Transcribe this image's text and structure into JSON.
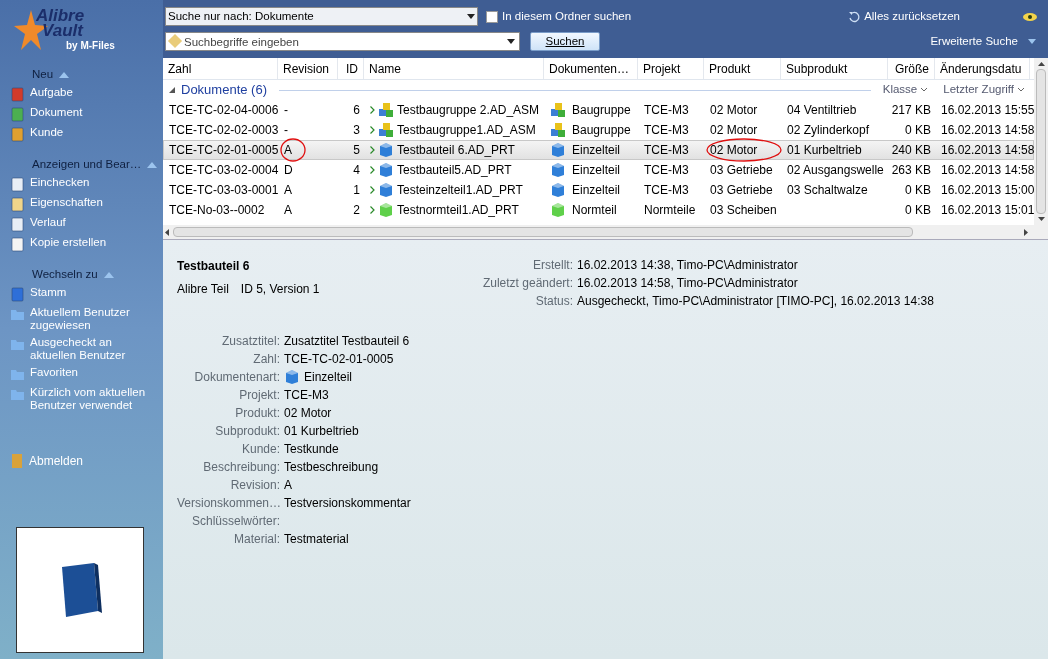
{
  "logo": {
    "line1": "Alibre",
    "line2": "Vault",
    "byline": "by M-Files"
  },
  "sidebar": {
    "sections": [
      {
        "title": "Neu",
        "items": [
          {
            "label": "Aufgabe"
          },
          {
            "label": "Dokument"
          },
          {
            "label": "Kunde"
          }
        ]
      },
      {
        "title": "Anzeigen und Bear…",
        "items": [
          {
            "label": "Einchecken"
          },
          {
            "label": "Eigenschaften"
          },
          {
            "label": "Verlauf"
          },
          {
            "label": "Kopie erstellen"
          }
        ]
      },
      {
        "title": "Wechseln zu",
        "items": [
          {
            "label": "Stamm"
          },
          {
            "label": "Aktuellem Benutzer zugewiesen"
          },
          {
            "label": "Ausgecheckt an aktuellen Benutzer"
          },
          {
            "label": "Favoriten"
          },
          {
            "label": "Kürzlich vom aktuellen Benutzer verwendet"
          }
        ]
      }
    ],
    "logout": "Abmelden"
  },
  "search": {
    "scope": "Suche nur nach: Dokumente",
    "in_folder_label": "In diesem Ordner suchen",
    "in_folder_checked": false,
    "placeholder": "Suchbegriffe eingeben",
    "button": "Suchen",
    "reset": "Alles zurücksetzen",
    "advanced": "Erweiterte Suche"
  },
  "table": {
    "columns": [
      "Zahl",
      "Revision",
      "ID",
      "Name",
      "Dokumenten…",
      "Projekt",
      "Produkt",
      "Subprodukt",
      "Größe",
      "Änderungsdatu"
    ],
    "group": "Dokumente (6)",
    "group_sort": [
      "Klasse",
      "Letzter Zugriff"
    ],
    "rows": [
      {
        "cells": [
          "TCE-TC-02-04-0006",
          "-",
          "6",
          "Testbaugruppe 2.AD_ASM",
          "Baugruppe",
          "TCE-M3",
          "02 Motor",
          "04 Ventiltrieb",
          "217 KB",
          "16.02.2013 15:55"
        ],
        "kind": "assembly",
        "selected": false,
        "revision_circled": false,
        "product_circled": false
      },
      {
        "cells": [
          "TCE-TC-02-02-0003",
          "-",
          "3",
          "Testbaugruppe1.AD_ASM",
          "Baugruppe",
          "TCE-M3",
          "02 Motor",
          "02 Zylinderkopf",
          "0 KB",
          "16.02.2013 14:58"
        ],
        "kind": "assembly",
        "selected": false,
        "revision_circled": false,
        "product_circled": false
      },
      {
        "cells": [
          "TCE-TC-02-01-0005",
          "A",
          "5",
          "Testbauteil 6.AD_PRT",
          "Einzelteil",
          "TCE-M3",
          "02 Motor",
          "01 Kurbeltrieb",
          "240 KB",
          "16.02.2013 14:58"
        ],
        "kind": "part",
        "selected": true,
        "revision_circled": true,
        "product_circled": true
      },
      {
        "cells": [
          "TCE-TC-03-02-0004",
          "D",
          "4",
          "Testbauteil5.AD_PRT",
          "Einzelteil",
          "TCE-M3",
          "03 Getriebe",
          "02 Ausgangswelle",
          "263 KB",
          "16.02.2013 14:58"
        ],
        "kind": "part",
        "selected": false,
        "revision_circled": false,
        "product_circled": false
      },
      {
        "cells": [
          "TCE-TC-03-03-0001",
          "A",
          "1",
          "Testeinzelteil1.AD_PRT",
          "Einzelteil",
          "TCE-M3",
          "03 Getriebe",
          "03 Schaltwalze",
          "0 KB",
          "16.02.2013 15:00"
        ],
        "kind": "part",
        "selected": false,
        "revision_circled": false,
        "product_circled": false
      },
      {
        "cells": [
          "TCE-No-03--0002",
          "A",
          "2",
          "Testnormteil1.AD_PRT",
          "Normteil",
          "Normteile",
          "03 Scheiben",
          "",
          "0 KB",
          "16.02.2013 15:01"
        ],
        "kind": "standard",
        "selected": false,
        "revision_circled": false,
        "product_circled": false
      }
    ]
  },
  "details": {
    "title": "Testbauteil 6",
    "class": "Alibre Teil",
    "version": "ID 5, Version 1",
    "meta": [
      {
        "label": "Erstellt:",
        "value": "16.02.2013 14:38, Timo-PC\\Administrator"
      },
      {
        "label": "Zuletzt geändert:",
        "value": "16.02.2013 14:58, Timo-PC\\Administrator"
      },
      {
        "label": "Status:",
        "value": "Ausgecheckt, Timo-PC\\Administrator [TIMO-PC], 16.02.2013 14:38"
      }
    ],
    "properties": [
      {
        "label": "Zusatztitel:",
        "value": "Zusatztitel Testbauteil 6"
      },
      {
        "label": "Zahl:",
        "value": "TCE-TC-02-01-0005"
      },
      {
        "label": "Dokumentenart:",
        "value": "Einzelteil",
        "kind": "part"
      },
      {
        "label": "Projekt:",
        "value": "TCE-M3"
      },
      {
        "label": "Produkt:",
        "value": "02 Motor"
      },
      {
        "label": "Subprodukt:",
        "value": "01 Kurbeltrieb"
      },
      {
        "label": "Kunde:",
        "value": "Testkunde"
      },
      {
        "label": "Beschreibung:",
        "value": "Testbeschreibung"
      },
      {
        "label": "Revision:",
        "value": "A"
      },
      {
        "label": "Versionskommen…",
        "value": "Testversionskommentar"
      },
      {
        "label": "Schlüsselwörter:"
      },
      {
        "label": "Material:",
        "value": "Testmaterial"
      }
    ]
  }
}
